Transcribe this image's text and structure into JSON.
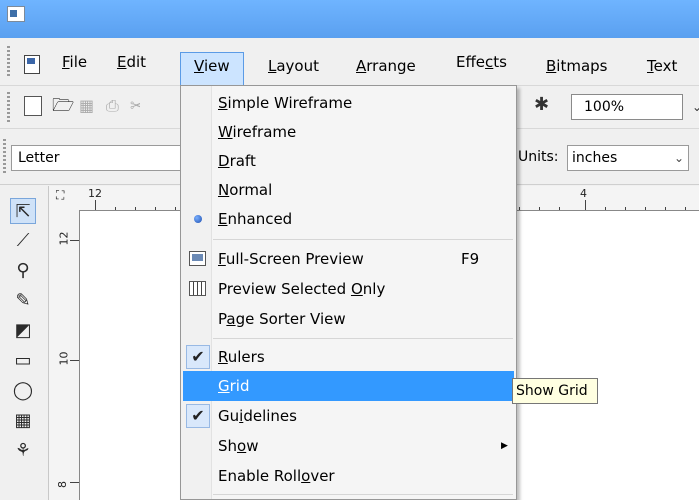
{
  "menubar": {
    "items": [
      {
        "label_pre": "",
        "mnemonic": "F",
        "label_post": "ile"
      },
      {
        "label_pre": "",
        "mnemonic": "E",
        "label_post": "dit"
      },
      {
        "label_pre": "",
        "mnemonic": "V",
        "label_post": "iew"
      },
      {
        "label_pre": "",
        "mnemonic": "L",
        "label_post": "ayout"
      },
      {
        "label_pre": "",
        "mnemonic": "A",
        "label_post": "rrange"
      },
      {
        "label_pre": "Effe",
        "mnemonic": "c",
        "label_post": "ts"
      },
      {
        "label_pre": "",
        "mnemonic": "B",
        "label_post": "itmaps"
      },
      {
        "label_pre": "",
        "mnemonic": "T",
        "label_post": "ext"
      }
    ]
  },
  "toolbar": {
    "zoom_value": "100%"
  },
  "propbar": {
    "paper": "Letter",
    "units_label": "Units:",
    "units_value": "inches"
  },
  "rulers": {
    "horizontal_labels": [
      "12",
      "4"
    ],
    "vertical_labels": [
      "12",
      "10",
      "8"
    ]
  },
  "view_menu": {
    "items": [
      {
        "pre": "",
        "mn": "S",
        "post": "imple Wireframe",
        "accel": ""
      },
      {
        "pre": "",
        "mn": "W",
        "post": "ireframe",
        "accel": ""
      },
      {
        "pre": "",
        "mn": "D",
        "post": "raft",
        "accel": ""
      },
      {
        "pre": "",
        "mn": "N",
        "post": "ormal",
        "accel": ""
      },
      {
        "pre": "",
        "mn": "E",
        "post": "nhanced",
        "accel": "",
        "state": "radio-selected"
      },
      {
        "pre": "",
        "mn": "F",
        "post": "ull-Screen Preview",
        "accel": "F9",
        "icon": "monitor-icon"
      },
      {
        "pre": "Preview Selected ",
        "mn": "O",
        "post": "nly",
        "accel": "",
        "icon": "grid-preview-icon"
      },
      {
        "pre": "P",
        "mn": "a",
        "post": "ge Sorter View",
        "accel": ""
      },
      {
        "pre": "",
        "mn": "R",
        "post": "ulers",
        "accel": "",
        "state": "checked"
      },
      {
        "pre": "",
        "mn": "G",
        "post": "rid",
        "accel": "",
        "state": "highlighted"
      },
      {
        "pre": "Gu",
        "mn": "i",
        "post": "delines",
        "accel": "",
        "state": "checked"
      },
      {
        "pre": "Sh",
        "mn": "o",
        "post": "w",
        "accel": "",
        "submenu": true
      },
      {
        "pre": "Enable Roll",
        "mn": "o",
        "post": "ver",
        "accel": ""
      }
    ]
  },
  "tooltip": {
    "text": "Show Grid"
  }
}
